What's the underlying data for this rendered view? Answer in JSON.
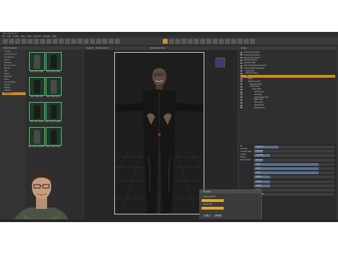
{
  "window": {
    "title": "Daz Studio 4.x"
  },
  "menu": [
    "File",
    "Edit",
    "Create",
    "View",
    "Tools",
    "Connect",
    "Window",
    "Help"
  ],
  "content_library": {
    "tab_label": "Smart Content",
    "categories": [
      "All Files",
      "Lost and Found",
      "Accessories",
      "Actors",
      "Cameras",
      "Environments",
      "Figures",
      "Hair",
      "Lights",
      "Materials",
      "Poses",
      "Scene Builder",
      "Scenes",
      "Shaping",
      "Utilities",
      "Wardrobe"
    ],
    "selected_category": "Wardrobe",
    "items": [
      {
        "label": "Basic Wear Outfit"
      },
      {
        "label": "Basic Wear Outfit"
      },
      {
        "label": "Basic Wear Shirt"
      },
      {
        "label": "Basic Wear Shorts"
      },
      {
        "label": "Basic Wear Shoes"
      },
      {
        "label": "Basic Wear Sneakers"
      },
      {
        "label": "Basic Wear Sweatshirt"
      },
      {
        "label": "Basic Wear T-Shirt"
      }
    ]
  },
  "viewport": {
    "tabs": [
      "Viewport",
      "Render Library"
    ],
    "label": "Perspective View"
  },
  "scene": {
    "tab_label": "Scene",
    "rows": [
      {
        "label": "Environment Options",
        "indent": 0,
        "selected": false
      },
      {
        "label": "Environment Options",
        "indent": 0,
        "selected": false
      },
      {
        "label": "Basic Female Holdout",
        "indent": 0,
        "selected": false
      },
      {
        "label": "Genesis 8 Female",
        "indent": 0,
        "selected": false
      },
      {
        "label": "Genesis 8 Male",
        "indent": 0,
        "selected": false
      },
      {
        "label": "Genesis 8 Female Subsurface",
        "indent": 0,
        "selected": false
      },
      {
        "label": "Genesis 8 Male Subsurface",
        "indent": 0,
        "selected": false
      },
      {
        "label": "Ricard Hair",
        "indent": 1,
        "selected": false
      },
      {
        "label": "Bodysuit Shape",
        "indent": 1,
        "selected": false
      },
      {
        "label": "Hip",
        "indent": 1,
        "selected": true
      },
      {
        "label": "Pelvis",
        "indent": 2,
        "selected": false
      },
      {
        "label": "Abdomen Lower",
        "indent": 2,
        "selected": false
      },
      {
        "label": "Abdomen Upper",
        "indent": 3,
        "selected": false
      },
      {
        "label": "Chest Lower",
        "indent": 3,
        "selected": false
      },
      {
        "label": "Chest Upper",
        "indent": 4,
        "selected": false
      },
      {
        "label": "Left Pectoral",
        "indent": 5,
        "selected": false
      },
      {
        "label": "Left Collar",
        "indent": 5,
        "selected": false
      },
      {
        "label": "Left Shoulder Bend",
        "indent": 5,
        "selected": false
      },
      {
        "label": "Right Collar",
        "indent": 5,
        "selected": false
      },
      {
        "label": "Neck Lower",
        "indent": 5,
        "selected": false
      },
      {
        "label": "Left Pectoral",
        "indent": 5,
        "selected": false
      },
      {
        "label": "Right Pectoral",
        "indent": 5,
        "selected": false
      }
    ]
  },
  "parameters": {
    "groups": [
      "All",
      "Favorites",
      "Currently Used",
      "General",
      "Morphs",
      "Pose Controls"
    ],
    "rows": [
      {
        "label": "Translate",
        "level": 0.3
      },
      {
        "label": "Translate",
        "level": 0.1
      },
      {
        "label": "Translate",
        "level": 0.2
      },
      {
        "label": "Translate",
        "level": 0.1
      },
      {
        "label": "Scale",
        "level": 0.8
      },
      {
        "label": "Scale",
        "level": 0.8
      },
      {
        "label": "Scale",
        "level": 0.8
      },
      {
        "label": "Rotate",
        "level": 0.2
      },
      {
        "label": "Rotate",
        "level": 0.2
      },
      {
        "label": "Rotate",
        "level": 0.2
      },
      {
        "label": "Visible",
        "level": 0.0
      },
      {
        "label": "Selectable",
        "level": 0.0
      }
    ]
  },
  "progress_dialog": {
    "title": "Progress",
    "message": "Loading Content",
    "progress": 0.9,
    "progress2": 0.9,
    "detail": "Loaded Files",
    "ok_label": "OK",
    "cancel_label": "Cancel"
  },
  "colors": {
    "accent": "#d48a1a",
    "thumb_border": "#5fbf7a",
    "panel": "#2f2f2f"
  }
}
